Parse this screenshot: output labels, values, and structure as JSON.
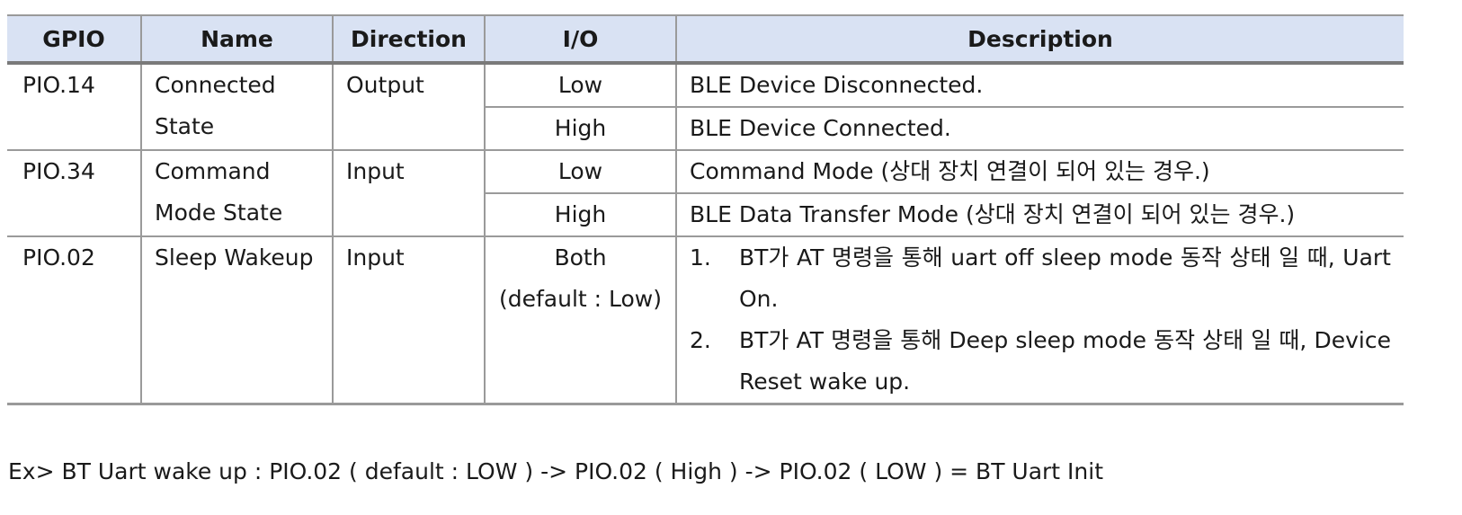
{
  "table": {
    "headers": [
      "GPIO",
      "Name",
      "Direction",
      "I/O",
      "Description"
    ],
    "rows": [
      {
        "gpio": "PIO.14",
        "name": [
          "Connected",
          "State"
        ],
        "direction": "Output",
        "io": [
          {
            "level": "Low",
            "description": "BLE Device Disconnected."
          },
          {
            "level": "High",
            "description": "BLE Device Connected."
          }
        ]
      },
      {
        "gpio": "PIO.34",
        "name": [
          "Command",
          "Mode State"
        ],
        "direction": "Input",
        "io": [
          {
            "level": "Low",
            "description": "Command Mode (상대 장치 연결이 되어 있는 경우.)"
          },
          {
            "level": "High",
            "description": "BLE Data Transfer Mode (상대 장치 연결이 되어 있는 경우.)"
          }
        ]
      },
      {
        "gpio": "PIO.02",
        "name": [
          "Sleep Wakeup"
        ],
        "direction": "Input",
        "io_level": [
          "Both",
          "(default : Low)"
        ],
        "description_items": [
          {
            "num": "1.",
            "text": "BT가 AT 명령을 통해 uart off sleep mode 동작 상태 일 때, Uart On."
          },
          {
            "num": "2.",
            "text": "BT가 AT 명령을 통해 Deep sleep mode 동작 상태 일 때, Device Reset wake up."
          }
        ]
      }
    ]
  },
  "example": "Ex> BT Uart wake up : PIO.02 ( default : LOW ) -> PIO.02 ( High ) -> PIO.02 ( LOW ) = BT Uart Init"
}
